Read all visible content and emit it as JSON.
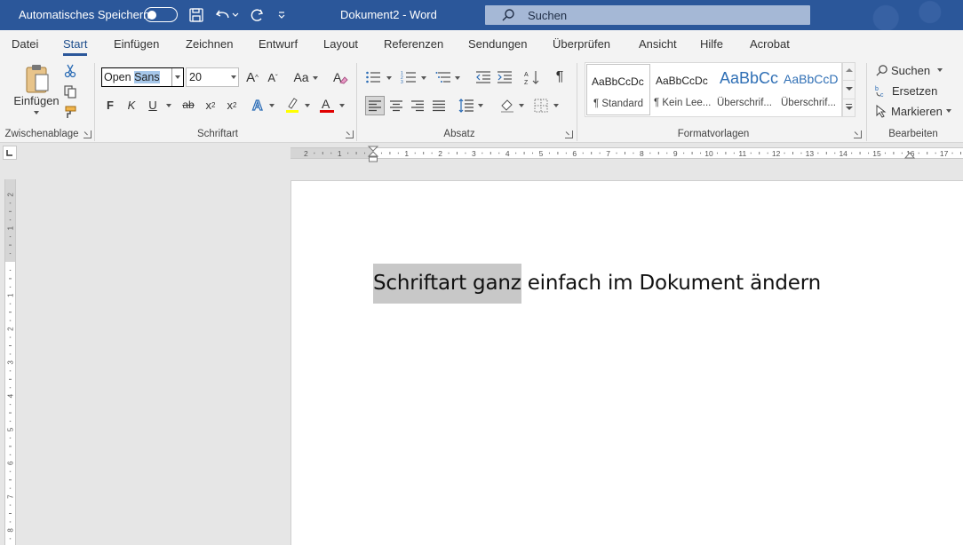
{
  "titlebar": {
    "autosave_label": "Automatisches Speichern",
    "autosave_state": "off",
    "document_title": "Dokument2  -  Word",
    "search_label": "Suchen"
  },
  "tabs": [
    {
      "label": "Datei"
    },
    {
      "label": "Start"
    },
    {
      "label": "Einfügen"
    },
    {
      "label": "Zeichnen"
    },
    {
      "label": "Entwurf"
    },
    {
      "label": "Layout"
    },
    {
      "label": "Referenzen"
    },
    {
      "label": "Sendungen"
    },
    {
      "label": "Überprüfen"
    },
    {
      "label": "Ansicht"
    },
    {
      "label": "Hilfe"
    },
    {
      "label": "Acrobat"
    }
  ],
  "active_tab": "Start",
  "ribbon": {
    "clipboard": {
      "paste_label": "Einfügen",
      "group_label": "Zwischenablage"
    },
    "font": {
      "font_name_prefix": "Open",
      "font_name_selected": "Sans",
      "font_size": "20",
      "bold_label": "F",
      "italic_label": "K",
      "underline_label": "U",
      "strike_label": "ab",
      "subscript_label": "x",
      "superscript_label": "x",
      "change_case_label": "Aa",
      "group_label": "Schriftart",
      "highlight_color": "#ffff00",
      "font_color": "#e00000"
    },
    "paragraph": {
      "group_label": "Absatz"
    },
    "styles": {
      "group_label": "Formatvorlagen",
      "items": [
        {
          "preview": "AaBbCcDc",
          "name": "¶ Standard"
        },
        {
          "preview": "AaBbCcDc",
          "name": "¶ Kein Lee..."
        },
        {
          "preview": "AaBbCc",
          "name": "Überschrif..."
        },
        {
          "preview": "AaBbCcD",
          "name": "Überschrif..."
        }
      ]
    },
    "editing": {
      "group_label": "Bearbeiten",
      "find_label": "Suchen",
      "replace_label": "Ersetzen",
      "select_label": "Markieren"
    }
  },
  "document": {
    "text_selected": "Schriftart ganz",
    "text_rest": " einfach im Dokument ändern"
  },
  "colors": {
    "titlebar": "#2b579a",
    "accent": "#2b579a"
  }
}
